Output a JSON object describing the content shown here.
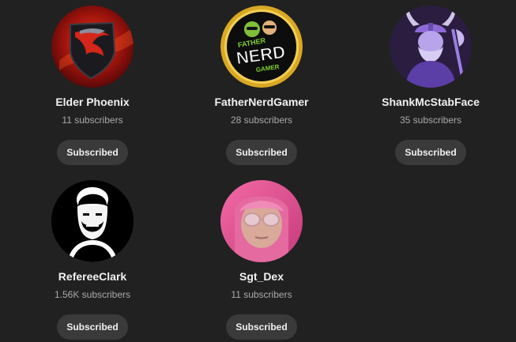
{
  "channels": [
    {
      "name": "Elder Phoenix",
      "subscribers": "11 subscribers",
      "button": "Subscribed",
      "avatar_icon": "phoenix-shield-icon",
      "accent": "#b31a12"
    },
    {
      "name": "FatherNerdGamer",
      "subscribers": "28 subscribers",
      "button": "Subscribed",
      "avatar_icon": "nerd-gamer-logo-icon",
      "avatar_logo_text": [
        "FATHER",
        "NERD",
        "GAMER"
      ],
      "accent": "#d7a51e"
    },
    {
      "name": "ShankMcStabFace",
      "subscribers": "35 subscribers",
      "button": "Subscribed",
      "avatar_icon": "viking-warrior-icon",
      "accent": "#7b4fd0"
    },
    {
      "name": "RefereeClark",
      "subscribers": "1.56K subscribers",
      "button": "Subscribed",
      "avatar_icon": "bearded-man-illustration-icon",
      "accent": "#000000"
    },
    {
      "name": "Sgt_Dex",
      "subscribers": "11 subscribers",
      "button": "Subscribed",
      "avatar_icon": "person-photo-icon",
      "accent": "#e6508e"
    }
  ]
}
